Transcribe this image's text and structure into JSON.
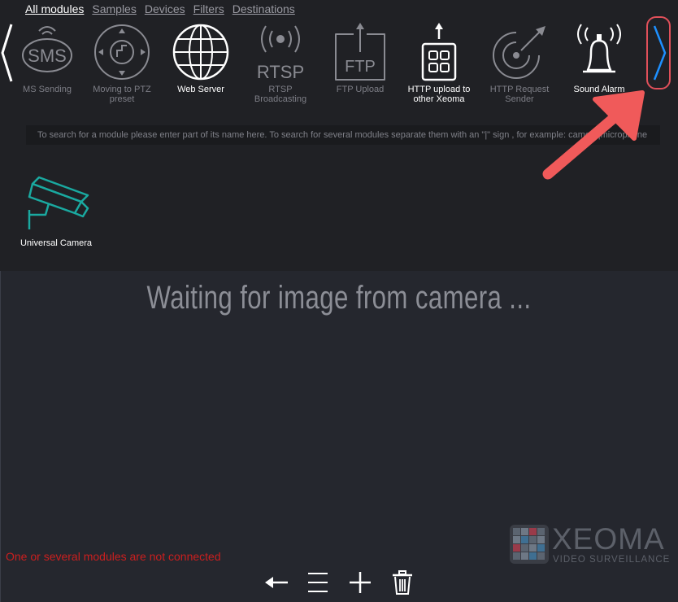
{
  "tabs": [
    {
      "label": "All modules",
      "active": true
    },
    {
      "label": "Samples",
      "active": false
    },
    {
      "label": "Devices",
      "active": false
    },
    {
      "label": "Filters",
      "active": false
    },
    {
      "label": "Destinations",
      "active": false
    }
  ],
  "modules": [
    {
      "label": "MS Sending",
      "icon": "sms-icon"
    },
    {
      "label": "Moving to PTZ preset",
      "icon": "ptz-preset-icon"
    },
    {
      "label": "Web Server",
      "icon": "globe-icon"
    },
    {
      "label": "RTSP Broadcasting",
      "icon": "rtsp-icon"
    },
    {
      "label": "FTP Upload",
      "icon": "ftp-upload-icon"
    },
    {
      "label": "HTTP upload to other Xeoma",
      "icon": "http-upload-icon"
    },
    {
      "label": "HTTP Request Sender",
      "icon": "http-request-icon"
    },
    {
      "label": "Sound Alarm",
      "icon": "bell-icon"
    }
  ],
  "icon_text": {
    "sms": "SMS",
    "rtsp": "RTSP",
    "ftp": "FTP"
  },
  "search_hint": "To search for a module please enter part of its name here. To search for several modules separate them with an \"|\" sign , for example: camera|microphone",
  "camera_module": {
    "label": "Universal Camera",
    "icon": "camera-icon"
  },
  "waiting_text": "Waiting for image from camera ...",
  "warning_text": "One or several modules are not connected",
  "logo": {
    "word": "XEOMA",
    "sub": "VIDEO SURVEILLANCE"
  },
  "toolbar": {
    "back": "back-arrow-icon",
    "menu": "menu-icon",
    "add": "plus-icon",
    "delete": "trash-icon"
  },
  "colors": {
    "background": "#25272e",
    "panel": "#202125",
    "accent_blue": "#1e90ff",
    "highlight_red": "#e0505a",
    "camera_teal": "#1aa9a0",
    "warning_red": "#cc1f1f"
  }
}
